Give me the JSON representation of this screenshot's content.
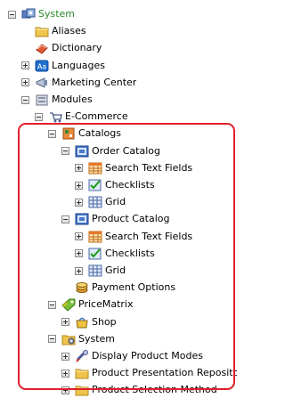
{
  "tree": [
    {
      "label": "System",
      "color": "green",
      "icon": "system-settings-icon",
      "expander": "minus",
      "level": 0
    },
    {
      "label": "Aliases",
      "icon": "folder-icon",
      "expander": "none",
      "level": 1
    },
    {
      "label": "Dictionary",
      "icon": "dictionary-icon",
      "expander": "none",
      "level": 1
    },
    {
      "label": "Languages",
      "icon": "language-icon",
      "expander": "plus",
      "level": 1
    },
    {
      "label": "Marketing Center",
      "icon": "marketing-icon",
      "expander": "plus",
      "level": 1
    },
    {
      "label": "Modules",
      "icon": "modules-icon",
      "expander": "minus",
      "level": 1
    },
    {
      "label": "E-Commerce",
      "icon": "ecommerce-icon",
      "expander": "minus",
      "level": 2
    },
    {
      "label": "Catalogs",
      "icon": "catalogs-icon",
      "expander": "minus",
      "level": 3
    },
    {
      "label": "Order Catalog",
      "icon": "catalog-icon",
      "expander": "minus",
      "level": 4
    },
    {
      "label": "Search Text Fields",
      "icon": "table-icon",
      "expander": "plus",
      "level": 5
    },
    {
      "label": "Checklists",
      "icon": "checklist-icon",
      "expander": "plus",
      "level": 5
    },
    {
      "label": "Grid",
      "icon": "grid-icon",
      "expander": "plus",
      "level": 5
    },
    {
      "label": "Product Catalog",
      "icon": "catalog-icon",
      "expander": "minus",
      "level": 4
    },
    {
      "label": "Search Text Fields",
      "icon": "table-icon",
      "expander": "plus",
      "level": 5
    },
    {
      "label": "Checklists",
      "icon": "checklist-icon",
      "expander": "plus",
      "level": 5
    },
    {
      "label": "Grid",
      "icon": "grid-icon",
      "expander": "plus",
      "level": 5
    },
    {
      "label": "Payment Options",
      "icon": "payment-icon",
      "expander": "none",
      "level": 4
    },
    {
      "label": "PriceMatrix",
      "icon": "pricematrix-icon",
      "expander": "minus",
      "level": 3
    },
    {
      "label": "Shop",
      "icon": "shop-icon",
      "expander": "plus",
      "level": 4
    },
    {
      "label": "System",
      "icon": "settings-icon",
      "expander": "minus",
      "level": 3
    },
    {
      "label": "Display Product Modes",
      "icon": "display-modes-icon",
      "expander": "plus",
      "level": 4
    },
    {
      "label": "Product Presentation Repository",
      "icon": "folder-icon",
      "expander": "plus",
      "level": 4
    },
    {
      "label": "Product Selection Method",
      "icon": "folder-icon",
      "expander": "plus",
      "level": 4
    }
  ]
}
